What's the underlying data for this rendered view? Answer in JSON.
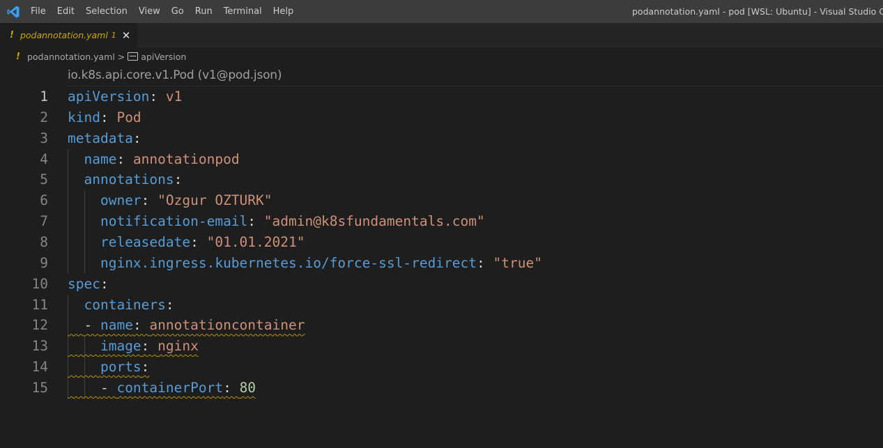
{
  "titlebar": {
    "menu": [
      "File",
      "Edit",
      "Selection",
      "View",
      "Go",
      "Run",
      "Terminal",
      "Help"
    ],
    "window_title": "podannotation.yaml - pod [WSL: Ubuntu] - Visual Studio Code"
  },
  "tab": {
    "warn_glyph": "!",
    "name": "podannotation.yaml",
    "problems_count": "1",
    "close_glyph": "✕"
  },
  "breadcrumb": {
    "warn_glyph": "!",
    "file": "podannotation.yaml",
    "separator": ">",
    "symbol": "apiVersion"
  },
  "codelens": {
    "schema": "io.k8s.api.core.v1.Pod (v1@pod.json)"
  },
  "editor": {
    "lines": [
      {
        "n": "1",
        "key": "apiVersion",
        "sep": ": ",
        "val": "v1"
      },
      {
        "n": "2",
        "key": "kind",
        "sep": ": ",
        "val": "Pod"
      },
      {
        "n": "3",
        "key": "metadata",
        "sep": ":",
        "val": ""
      },
      {
        "n": "4",
        "indent": "  ",
        "key": "name",
        "sep": ": ",
        "val": "annotationpod"
      },
      {
        "n": "5",
        "indent": "  ",
        "key": "annotations",
        "sep": ":",
        "val": ""
      },
      {
        "n": "6",
        "indent": "    ",
        "key": "owner",
        "sep": ": ",
        "val": "\"Ozgur OZTURK\""
      },
      {
        "n": "7",
        "indent": "    ",
        "key": "notification-email",
        "sep": ": ",
        "val": "\"admin@k8sfundamentals.com\""
      },
      {
        "n": "8",
        "indent": "    ",
        "key": "releasedate",
        "sep": ": ",
        "val": "\"01.01.2021\""
      },
      {
        "n": "9",
        "indent": "    ",
        "key": "nginx.ingress.kubernetes.io/force-ssl-redirect",
        "sep": ": ",
        "val": "\"true\""
      },
      {
        "n": "10",
        "key": "spec",
        "sep": ":",
        "val": ""
      },
      {
        "n": "11",
        "indent": "  ",
        "key": "containers",
        "sep": ":",
        "val": ""
      },
      {
        "n": "12",
        "indent": "  ",
        "dash": "- ",
        "key": "name",
        "sep": ": ",
        "val": "annotationcontainer"
      },
      {
        "n": "13",
        "indent": "    ",
        "key": "image",
        "sep": ": ",
        "val": "nginx"
      },
      {
        "n": "14",
        "indent": "    ",
        "key": "ports",
        "sep": ":",
        "val": ""
      },
      {
        "n": "15",
        "indent": "    ",
        "dash": "- ",
        "key": "containerPort",
        "sep": ": ",
        "val": "80",
        "numeric": true
      }
    ]
  },
  "colors": {
    "key": "#569cd6",
    "string": "#ce9178",
    "number": "#b5cea8",
    "warning": "#cca700",
    "background": "#1e1e1e"
  }
}
